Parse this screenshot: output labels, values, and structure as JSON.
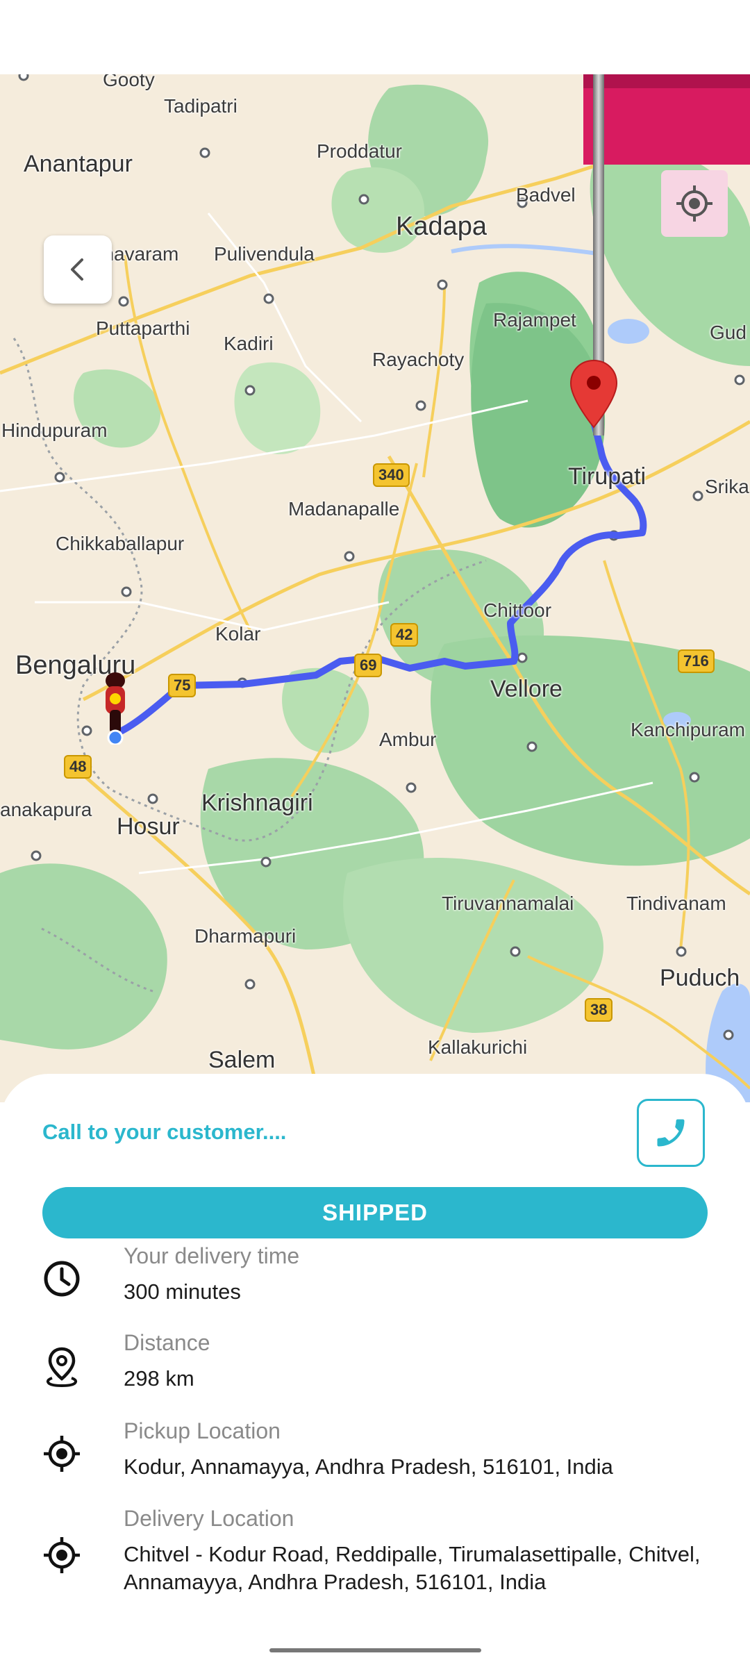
{
  "map": {
    "labels": {
      "gooty": "Gooty",
      "tadipatri": "Tadipatri",
      "anantapur": "Anantapur",
      "proddatur": "Proddatur",
      "badvel": "Badvel",
      "kadapa": "Kadapa",
      "dharmavaram": "Dharmavaram",
      "pulivendula": "Pulivendula",
      "rajampet": "Rajampet",
      "gud": "Gud",
      "puttaparthi": "Puttaparthi",
      "kadiri": "Kadiri",
      "rayachoty": "Rayachoty",
      "hindupuram": "Hindupuram",
      "tirupati": "Tirupati",
      "srika": "Srika",
      "madanapalle": "Madanapalle",
      "chikkaballapur": "Chikkaballapur",
      "chittoor": "Chittoor",
      "kolar": "Kolar",
      "bengaluru": "Bengaluru",
      "vellore": "Vellore",
      "kanchipuram": "Kanchipuram",
      "ambur": "Ambur",
      "anakapura": "anakapura",
      "hosur": "Hosur",
      "krishnagiri": "Krishnagiri",
      "tiruvannamalai": "Tiruvannamalai",
      "tindivanam": "Tindivanam",
      "dharmapuri": "Dharmapuri",
      "puduch": "Puduch",
      "kallakurichi": "Kallakurichi",
      "salem": "Salem"
    },
    "highways": {
      "h340": "340",
      "h42": "42",
      "h69": "69",
      "h75": "75",
      "h716": "716",
      "h48": "48",
      "h38": "38"
    },
    "icons": {
      "back": "chevron-left-icon",
      "locate": "gps-crosshair-icon",
      "destination": "map-pin-icon",
      "rider": "delivery-scooter-icon",
      "flag": "pink-flag-icon"
    }
  },
  "sheet": {
    "call_text": "Call to your customer....",
    "status_button": "SHIPPED",
    "info": [
      {
        "label": "Your delivery time",
        "value": "300 minutes",
        "icon": "clock-icon"
      },
      {
        "label": "Distance",
        "value": "298 km",
        "icon": "location-pin-icon"
      },
      {
        "label": "Pickup Location",
        "value": "Kodur, Annamayya, Andhra Pradesh, 516101, India",
        "icon": "crosshair-icon"
      },
      {
        "label": "Delivery Location",
        "value": "Chitvel - Kodur Road, Reddipalle, Tirumalasettipalle, Chitvel, Annamayya, Andhra Pradesh, 516101, India",
        "icon": "crosshair-icon"
      }
    ]
  },
  "colors": {
    "accent": "#2bb7cd",
    "route": "#4a5cf0",
    "flag": "#d81b60",
    "pin": "#e53935"
  }
}
